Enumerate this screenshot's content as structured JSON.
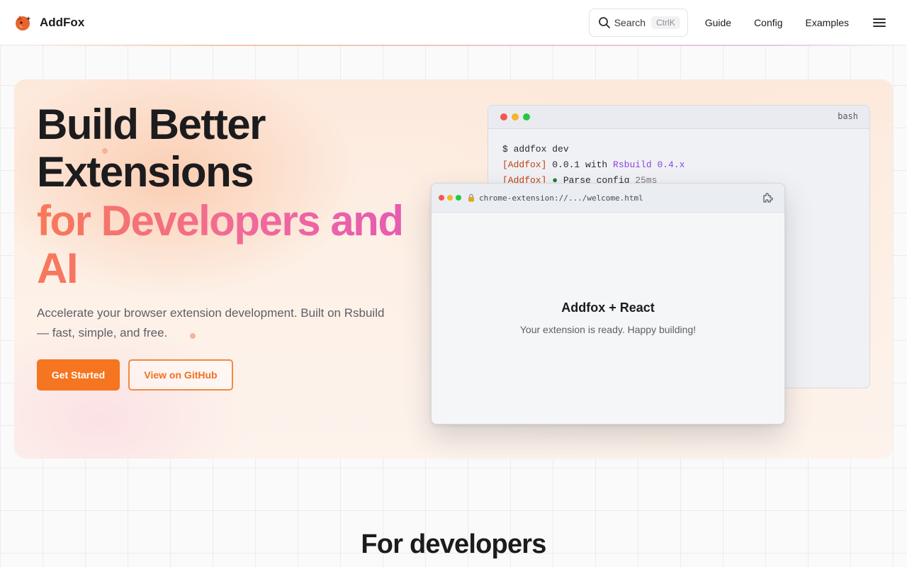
{
  "nav": {
    "brand": "AddFox",
    "search_label": "Search",
    "search_shortcut": "CtrlK",
    "links": [
      "Guide",
      "Config",
      "Examples"
    ]
  },
  "hero": {
    "title_line1": "Build Better",
    "title_line2": "Extensions",
    "title_accent": "for Developers and AI",
    "subtitle": "Accelerate your browser extension development. Built on Rsbuild — fast, simple, and free.",
    "primary_button": "Get Started",
    "secondary_button": "View on GitHub"
  },
  "terminal": {
    "title": "bash",
    "prompt": "$ addfox dev",
    "line2_tag": "[Addfox]",
    "line2_text": " 0.0.1 with ",
    "line2_highlight": "Rsbuild 0.4.x",
    "line3_tag": "[Addfox]",
    "line3_bullet": " ● ",
    "line3_text": "Parse config ",
    "line3_time": "25ms"
  },
  "browser": {
    "url": "chrome-extension://.../welcome.html",
    "heading": "Addfox + React",
    "text": "Your extension is ready. Happy building!"
  },
  "section": {
    "title": "For developers"
  },
  "colors": {
    "accent": "#f57520",
    "gradient_start": "#f87958",
    "gradient_end": "#e359b6"
  }
}
